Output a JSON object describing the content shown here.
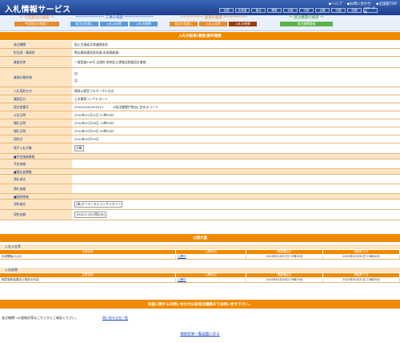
{
  "header": {
    "title": "入札情報サービス",
    "links": [
      "◆ヘルプ",
      "◆お問い合わせ",
      "◆全国版TOP"
    ],
    "regions": [
      "全国",
      "北海道",
      "東北",
      "関東",
      "北陸",
      "中部",
      "近畿",
      "中国",
      "四国",
      "九州・沖縄"
    ]
  },
  "nav": {
    "groups": [
      {
        "title": "** 今回発注の検索 **",
        "tabs": [
          "今回発注の検索 1"
        ],
        "color": "#5a9bd6"
      },
      {
        "title": "**************** 工事の検索 ****************",
        "tabs": [
          "発注の見通し",
          "入札公告等",
          "入札の結果"
        ],
        "color": "#5a9bd6"
      },
      {
        "title": "************* 業務の検索 *************",
        "tabs": [
          "発注の見通し",
          "入札公告等",
          "入札の結果"
        ],
        "color": "#e98b2a"
      },
      {
        "title": "** 発注機関の検索 **",
        "tabs": [
          "発注機関情報"
        ],
        "color": "#5bb34a"
      }
    ]
  },
  "detail": {
    "heading": "入札の結果(業務)案件概要",
    "rows": [
      {
        "label": "発注機関",
        "value": "国土交通省北海道開発局"
      },
      {
        "label": "担当部・事務所",
        "value": "帯広開発建設部本部(本部事業課)"
      },
      {
        "label": "業務名称",
        "value": "一般国道236号 広尾町 新地区災害復旧測量設計業務"
      },
      {
        "label": "業務対象地域",
        "value": "自：",
        "value2": "至："
      },
      {
        "label": "入札契約方式",
        "value": "簡易公募型プロポーザル方式"
      },
      {
        "label": "業務区分",
        "value": "土木関係コンサルタント"
      },
      {
        "label": "設計書番号",
        "value": "202420000200012",
        "note": "※発注機関が独自に定めるコード"
      },
      {
        "label": "公告日時",
        "value": "2024年01月31日 07時00分"
      },
      {
        "label": "開札日時",
        "value": "2024年01月18日 13時00分"
      },
      {
        "label": "開札日時",
        "value": "2024年03月25日 09時00分"
      },
      {
        "label": "契約日",
        "value": "2024年04月25日"
      },
      {
        "label": "電子入札対象",
        "value": "対象"
      }
    ],
    "predicted_price_section": "■予定価格情報",
    "predicted_price_label": "予定価格",
    "winner_section": "■落札者情報",
    "winner_name_label": "落札者名",
    "winner_amount_label": "落札価格",
    "contract_section": "■契約情報",
    "contract_rows": [
      {
        "label": "契約者名",
        "value": "(株)オリエンタルコンサルタンツ"
      },
      {
        "label": "契約金額",
        "value": "16,621,000(税込み)"
      }
    ]
  },
  "documents": {
    "heading": "公開文書",
    "columns": [
      "文書名称",
      "公開状況",
      "掲載開始日",
      "掲載終了日"
    ],
    "groups": [
      {
        "category": "入札公告等",
        "rows": [
          {
            "name": "手続開始の公示",
            "status": "公開中",
            "start": "2024年01月31日 07時00分",
            "end": "2025年01月31日 23時00分"
          }
        ]
      },
      {
        "category": "入札結果",
        "rows": [
          {
            "name": "随意契約結果及び契約の内容",
            "status": "公開中",
            "start": "2024年05月28日 09時19分",
            "end": "2025年05月31日 23時00分"
          }
        ]
      }
    ]
  },
  "inquiry": {
    "heading": "内容に関するお問い合わせは各発注機関までお問い合せ下さい。",
    "text": "発注機関への連絡先等はこちらからご確認ください。",
    "link": "問い合わせ先一覧"
  },
  "return_link": "検索結果一覧画面に戻る",
  "colors": {
    "orange": "#f08a00",
    "label_bg": "#fde5c3",
    "header_blue": "#1f3f8c"
  }
}
